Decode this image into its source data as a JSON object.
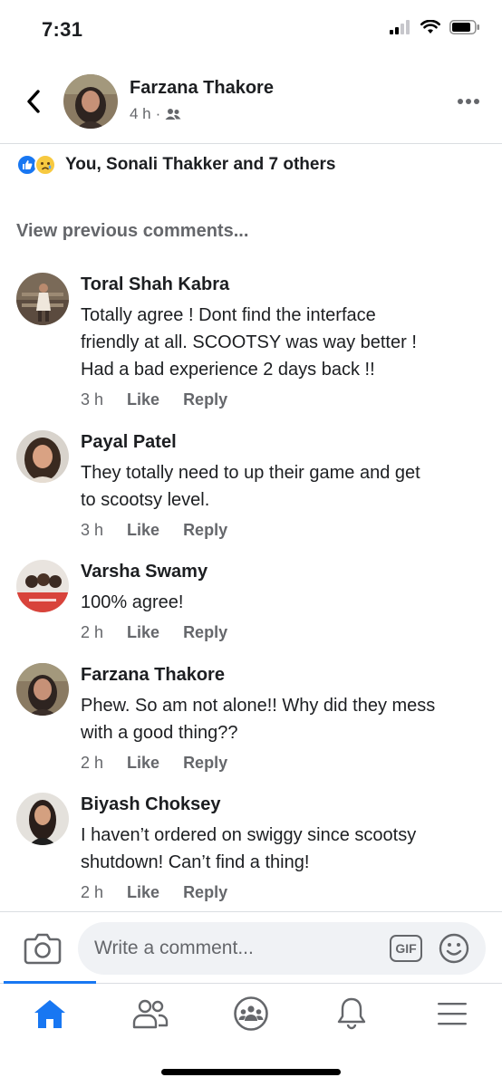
{
  "status": {
    "time": "7:31"
  },
  "post": {
    "author": "Farzana Thakore",
    "time": "4 h",
    "separator": "·",
    "reactions_text": "You, Sonali Thakker and 7 others"
  },
  "view_previous": "View previous comments...",
  "actions": {
    "like": "Like",
    "reply": "Reply"
  },
  "comments": [
    {
      "name": "Toral Shah Kabra",
      "text": "Totally agree ! Dont find the interface\nfriendly at all. SCOOTSY was way better !\nHad a bad experience 2 days back !!",
      "time": "3 h"
    },
    {
      "name": "Payal Patel",
      "text": "They totally need to up their game and get\nto scootsy level.",
      "time": "3 h"
    },
    {
      "name": "Varsha Swamy",
      "text": "100% agree!",
      "time": "2 h"
    },
    {
      "name": "Farzana Thakore",
      "text": "Phew. So am not alone!!  Why did they mess\nwith a good thing??",
      "time": "2 h"
    },
    {
      "name": "Biyash Choksey",
      "text": "I haven’t ordered on swiggy since scootsy\nshutdown! Can’t find a thing!",
      "time": "2 h"
    }
  ],
  "composer": {
    "placeholder": "Write a comment...",
    "gif": "GIF"
  },
  "icons": {
    "back": "chevron-left-icon",
    "more": "more-horizontal-icon",
    "friends": "friends-audience-icon",
    "camera": "camera-icon",
    "emoji": "emoji-icon",
    "tabs": [
      "home-icon",
      "friends-icon",
      "groups-icon",
      "notifications-icon",
      "menu-icon"
    ]
  },
  "colors": {
    "accent": "#1877f2",
    "secondary_text": "#65676b",
    "input_bg": "#f0f2f5"
  }
}
